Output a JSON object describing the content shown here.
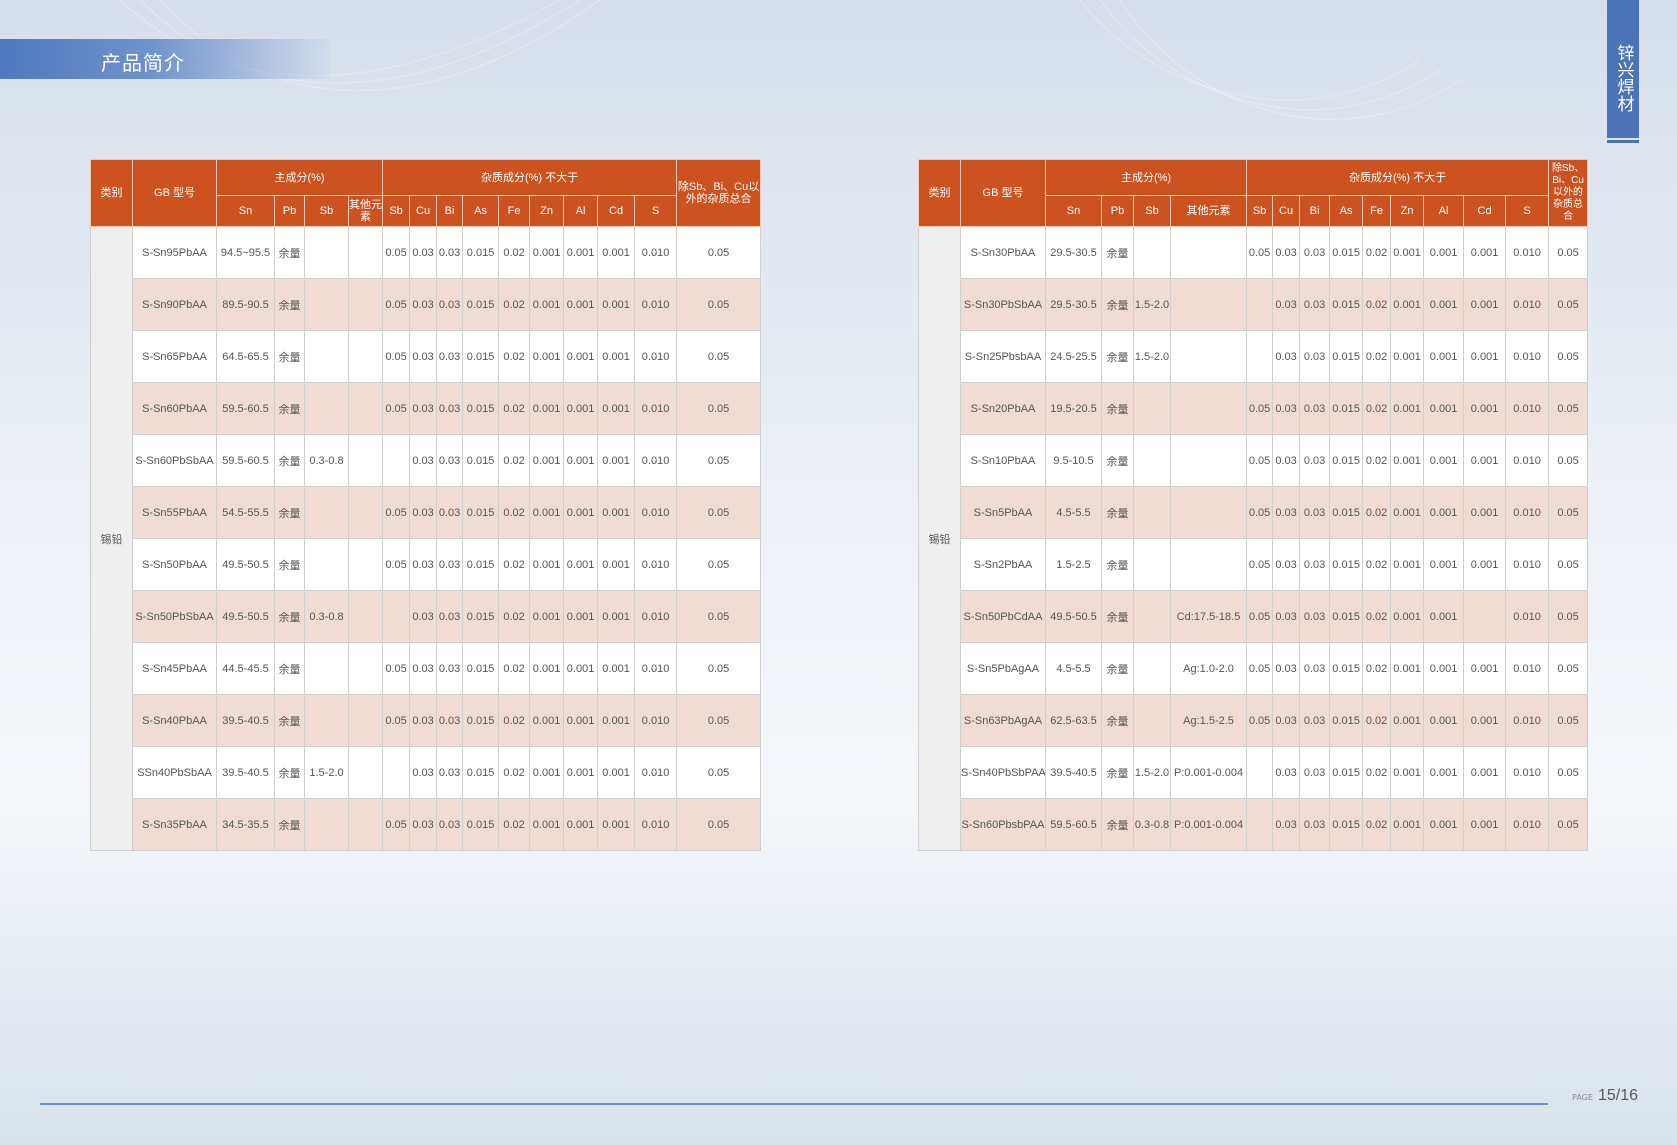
{
  "header": {
    "title": "产品简介",
    "brand": "锌兴焊材"
  },
  "footer": {
    "page_label": "PAGE",
    "page_number": "15/16"
  },
  "left_table": {
    "headers": {
      "category": "类别",
      "model": "GB 型号",
      "main": "主成分(%)",
      "impurity": "杂质成分(%) 不大于",
      "total": "除Sb、Bi、Cu以外的杂质总合",
      "main_cols": [
        "Sn",
        "Pb",
        "Sb",
        "其他元素"
      ],
      "imp_cols": [
        "Sb",
        "Cu",
        "Bi",
        "As",
        "Fe",
        "Zn",
        "Al",
        "Cd",
        "S"
      ]
    },
    "category": "锡铅",
    "rows": [
      [
        "S-Sn95PbAA",
        "94.5~95.5",
        "余量",
        "",
        "",
        "0.05",
        "0.03",
        "0.03",
        "0.015",
        "0.02",
        "0.001",
        "0.001",
        "0.001",
        "0.010",
        "0.05"
      ],
      [
        "S-Sn90PbAA",
        "89.5-90.5",
        "余量",
        "",
        "",
        "0.05",
        "0.03",
        "0.03",
        "0.015",
        "0.02",
        "0.001",
        "0.001",
        "0.001",
        "0.010",
        "0.05"
      ],
      [
        "S-Sn65PbAA",
        "64.5-65.5",
        "余量",
        "",
        "",
        "0.05",
        "0.03",
        "0.03",
        "0.015",
        "0.02",
        "0.001",
        "0.001",
        "0.001",
        "0.010",
        "0.05"
      ],
      [
        "S-Sn60PbAA",
        "59.5-60.5",
        "余量",
        "",
        "",
        "0.05",
        "0.03",
        "0.03",
        "0.015",
        "0.02",
        "0.001",
        "0.001",
        "0.001",
        "0.010",
        "0.05"
      ],
      [
        "S-Sn60PbSbAA",
        "59.5-60.5",
        "余量",
        "0.3-0.8",
        "",
        "",
        "0.03",
        "0.03",
        "0.015",
        "0.02",
        "0.001",
        "0.001",
        "0.001",
        "0.010",
        "0.05"
      ],
      [
        "S-Sn55PbAA",
        "54.5-55.5",
        "余量",
        "",
        "",
        "0.05",
        "0.03",
        "0.03",
        "0.015",
        "0.02",
        "0.001",
        "0.001",
        "0.001",
        "0.010",
        "0.05"
      ],
      [
        "S-Sn50PbAA",
        "49.5-50.5",
        "余量",
        "",
        "",
        "0.05",
        "0.03",
        "0.03",
        "0.015",
        "0.02",
        "0.001",
        "0.001",
        "0.001",
        "0.010",
        "0.05"
      ],
      [
        "S-Sn50PbSbAA",
        "49.5-50.5",
        "余量",
        "0.3-0.8",
        "",
        "",
        "0.03",
        "0.03",
        "0.015",
        "0.02",
        "0.001",
        "0.001",
        "0.001",
        "0.010",
        "0.05"
      ],
      [
        "S-Sn45PbAA",
        "44.5-45.5",
        "余量",
        "",
        "",
        "0.05",
        "0.03",
        "0.03",
        "0.015",
        "0.02",
        "0.001",
        "0.001",
        "0.001",
        "0.010",
        "0.05"
      ],
      [
        "S-Sn40PbAA",
        "39.5-40.5",
        "余量",
        "",
        "",
        "0.05",
        "0.03",
        "0.03",
        "0.015",
        "0.02",
        "0.001",
        "0.001",
        "0.001",
        "0.010",
        "0.05"
      ],
      [
        "SSn40PbSbAA",
        "39.5-40.5",
        "余量",
        "1.5-2.0",
        "",
        "",
        "0.03",
        "0.03",
        "0.015",
        "0.02",
        "0.001",
        "0.001",
        "0.001",
        "0.010",
        "0.05"
      ],
      [
        "S-Sn35PbAA",
        "34.5-35.5",
        "余量",
        "",
        "",
        "0.05",
        "0.03",
        "0.03",
        "0.015",
        "0.02",
        "0.001",
        "0.001",
        "0.001",
        "0.010",
        "0.05"
      ]
    ]
  },
  "right_table": {
    "headers": {
      "category": "类别",
      "model": "GB 型号",
      "main": "主成分(%)",
      "impurity": "杂质成分(%) 不大于",
      "total": "除Sb、Bi、Cu以外的杂质总合",
      "main_cols": [
        "Sn",
        "Pb",
        "Sb",
        "其他元素"
      ],
      "imp_cols": [
        "Sb",
        "Cu",
        "Bi",
        "As",
        "Fe",
        "Zn",
        "Al",
        "Cd",
        "S"
      ]
    },
    "category": "锡铅",
    "rows": [
      [
        "S-Sn30PbAA",
        "29.5-30.5",
        "余量",
        "",
        "",
        "0.05",
        "0.03",
        "0.03",
        "0.015",
        "0.02",
        "0.001",
        "0.001",
        "0.001",
        "0.010",
        "0.05"
      ],
      [
        "S-Sn30PbSbAA",
        "29.5-30.5",
        "余量",
        "1.5-2.0",
        "",
        "",
        "0.03",
        "0.03",
        "0.015",
        "0.02",
        "0.001",
        "0.001",
        "0.001",
        "0.010",
        "0.05"
      ],
      [
        "S-Sn25PbsbAA",
        "24.5-25.5",
        "余量",
        "1.5-2.0",
        "",
        "",
        "0.03",
        "0.03",
        "0.015",
        "0.02",
        "0.001",
        "0.001",
        "0.001",
        "0.010",
        "0.05"
      ],
      [
        "S-Sn20PbAA",
        "19.5-20.5",
        "余量",
        "",
        "",
        "0.05",
        "0.03",
        "0.03",
        "0.015",
        "0.02",
        "0.001",
        "0.001",
        "0.001",
        "0.010",
        "0.05"
      ],
      [
        "S-Sn10PbAA",
        "9.5-10.5",
        "余量",
        "",
        "",
        "0.05",
        "0.03",
        "0.03",
        "0.015",
        "0.02",
        "0.001",
        "0.001",
        "0.001",
        "0.010",
        "0.05"
      ],
      [
        "S-Sn5PbAA",
        "4.5-5.5",
        "余量",
        "",
        "",
        "0.05",
        "0.03",
        "0.03",
        "0.015",
        "0.02",
        "0.001",
        "0.001",
        "0.001",
        "0.010",
        "0.05"
      ],
      [
        "S-Sn2PbAA",
        "1.5-2.5",
        "余量",
        "",
        "",
        "0.05",
        "0.03",
        "0.03",
        "0.015",
        "0.02",
        "0.001",
        "0.001",
        "0.001",
        "0.010",
        "0.05"
      ],
      [
        "S-Sn50PbCdAA",
        "49.5-50.5",
        "余量",
        "",
        "Cd:17.5-18.5",
        "0.05",
        "0.03",
        "0.03",
        "0.015",
        "0.02",
        "0.001",
        "0.001",
        "",
        "0.010",
        "0.05"
      ],
      [
        "S-Sn5PbAgAA",
        "4.5-5.5",
        "余量",
        "",
        "Ag:1.0-2.0",
        "0.05",
        "0.03",
        "0.03",
        "0.015",
        "0.02",
        "0.001",
        "0.001",
        "0.001",
        "0.010",
        "0.05"
      ],
      [
        "S-Sn63PbAgAA",
        "62.5-63.5",
        "余量",
        "",
        "Ag:1.5-2.5",
        "0.05",
        "0.03",
        "0.03",
        "0.015",
        "0.02",
        "0.001",
        "0.001",
        "0.001",
        "0.010",
        "0.05"
      ],
      [
        "S-Sn40PbSbPAA",
        "39.5-40.5",
        "余量",
        "1.5-2.0",
        "P:0.001-0.004",
        "",
        "0.03",
        "0.03",
        "0.015",
        "0.02",
        "0.001",
        "0.001",
        "0.001",
        "0.010",
        "0.05"
      ],
      [
        "S-Sn60PbsbPAA",
        "59.5-60.5",
        "余量",
        "0.3-0.8",
        "P:0.001-0.004",
        "",
        "0.03",
        "0.03",
        "0.015",
        "0.02",
        "0.001",
        "0.001",
        "0.001",
        "0.010",
        "0.05"
      ]
    ]
  }
}
